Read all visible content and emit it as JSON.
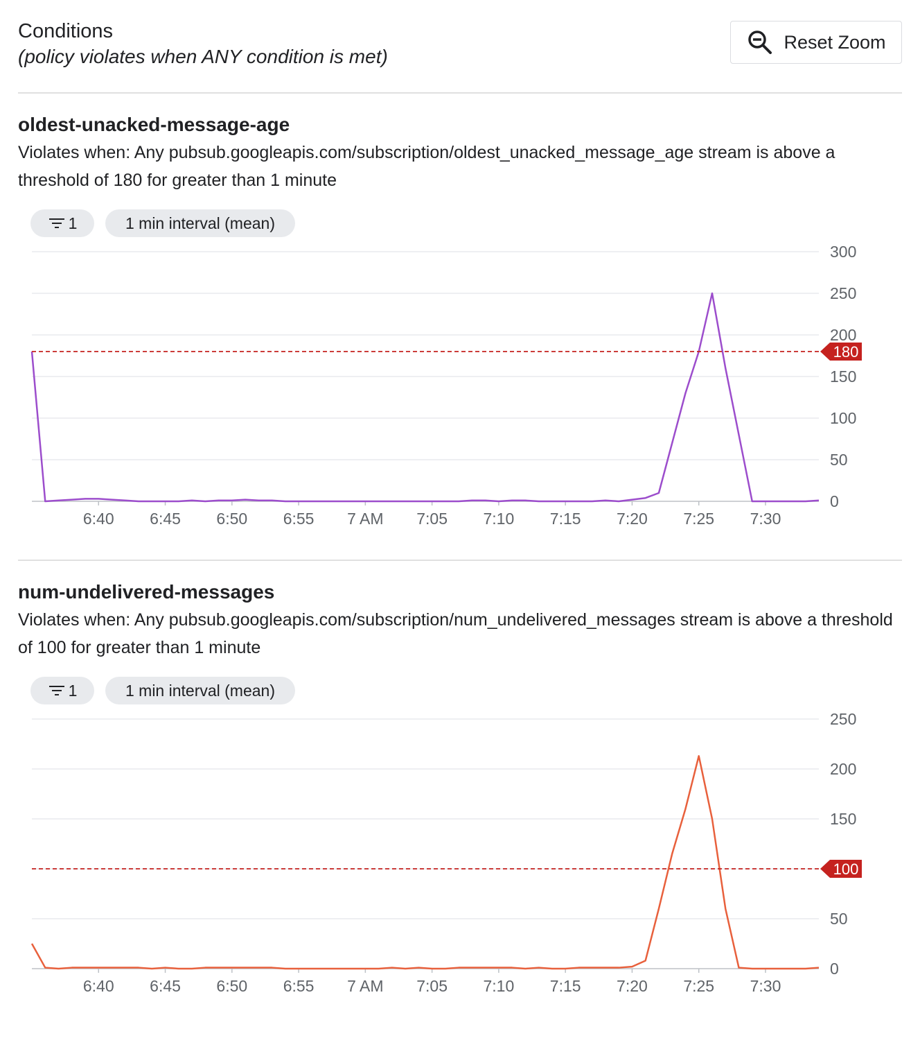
{
  "header": {
    "title": "Conditions",
    "subtitle": "(policy violates when ANY condition is met)",
    "reset_zoom_label": "Reset Zoom",
    "reset_zoom_icon": "zoom-out-icon"
  },
  "conditions": [
    {
      "name": "oldest-unacked-message-age",
      "description": "Violates when: Any pubsub.googleapis.com/subscription/oldest_unacked_message_age stream is above a threshold of 180 for greater than 1 minute",
      "filter_chip_icon": "filter-icon",
      "filter_chip_count": "1",
      "interval_chip": "1 min interval (mean)",
      "threshold_label": "180"
    },
    {
      "name": "num-undelivered-messages",
      "description": "Violates when: Any pubsub.googleapis.com/subscription/num_undelivered_messages stream is above a threshold of 100 for greater than 1 minute",
      "filter_chip_icon": "filter-icon",
      "filter_chip_count": "1",
      "interval_chip": "1 min interval (mean)",
      "threshold_label": "100"
    }
  ],
  "chart_data": [
    {
      "type": "line",
      "x_unit": "time",
      "x_ticks": [
        "6:40",
        "6:45",
        "6:50",
        "6:55",
        "7 AM",
        "7:05",
        "7:10",
        "7:15",
        "7:20",
        "7:25",
        "7:30"
      ],
      "y_ticks": [
        "0",
        "50",
        "100",
        "150",
        "200",
        "250",
        "300"
      ],
      "ylim": [
        0,
        300
      ],
      "xlim": [
        "6:35",
        "7:34"
      ],
      "grid": true,
      "threshold": 180,
      "series_color": "#9c4dcc",
      "threshold_color": "#c5221f",
      "series": [
        {
          "x": [
            "6:35",
            "6:36",
            "6:37",
            "6:38",
            "6:39",
            "6:40",
            "6:41",
            "6:42",
            "6:43",
            "6:44",
            "6:45",
            "6:46",
            "6:47",
            "6:48",
            "6:49",
            "6:50",
            "6:51",
            "6:52",
            "6:53",
            "6:54",
            "6:55",
            "6:56",
            "6:57",
            "6:58",
            "6:59",
            "7:00",
            "7:01",
            "7:02",
            "7:03",
            "7:04",
            "7:05",
            "7:06",
            "7:07",
            "7:08",
            "7:09",
            "7:10",
            "7:11",
            "7:12",
            "7:13",
            "7:14",
            "7:15",
            "7:16",
            "7:17",
            "7:18",
            "7:19",
            "7:20",
            "7:21",
            "7:22",
            "7:23",
            "7:24",
            "7:25",
            "7:26",
            "7:27",
            "7:28",
            "7:29",
            "7:30",
            "7:31",
            "7:32",
            "7:33",
            "7:34"
          ],
          "y": [
            180,
            0,
            1,
            2,
            3,
            3,
            2,
            1,
            0,
            0,
            0,
            0,
            1,
            0,
            1,
            1,
            2,
            1,
            1,
            0,
            0,
            0,
            0,
            0,
            0,
            0,
            0,
            0,
            0,
            0,
            0,
            0,
            0,
            1,
            1,
            0,
            1,
            1,
            0,
            0,
            0,
            0,
            0,
            1,
            0,
            2,
            4,
            10,
            70,
            130,
            180,
            250,
            160,
            80,
            0,
            0,
            0,
            0,
            0,
            1
          ]
        }
      ]
    },
    {
      "type": "line",
      "x_unit": "time",
      "x_ticks": [
        "6:40",
        "6:45",
        "6:50",
        "6:55",
        "7 AM",
        "7:05",
        "7:10",
        "7:15",
        "7:20",
        "7:25",
        "7:30"
      ],
      "y_ticks": [
        "0",
        "50",
        "100",
        "150",
        "200",
        "250"
      ],
      "ylim": [
        0,
        250
      ],
      "xlim": [
        "6:35",
        "7:34"
      ],
      "grid": true,
      "threshold": 100,
      "series_color": "#e8603c",
      "threshold_color": "#c5221f",
      "series": [
        {
          "x": [
            "6:35",
            "6:36",
            "6:37",
            "6:38",
            "6:39",
            "6:40",
            "6:41",
            "6:42",
            "6:43",
            "6:44",
            "6:45",
            "6:46",
            "6:47",
            "6:48",
            "6:49",
            "6:50",
            "6:51",
            "6:52",
            "6:53",
            "6:54",
            "6:55",
            "6:56",
            "6:57",
            "6:58",
            "6:59",
            "7:00",
            "7:01",
            "7:02",
            "7:03",
            "7:04",
            "7:05",
            "7:06",
            "7:07",
            "7:08",
            "7:09",
            "7:10",
            "7:11",
            "7:12",
            "7:13",
            "7:14",
            "7:15",
            "7:16",
            "7:17",
            "7:18",
            "7:19",
            "7:20",
            "7:21",
            "7:22",
            "7:23",
            "7:24",
            "7:25",
            "7:26",
            "7:27",
            "7:28",
            "7:29",
            "7:30",
            "7:31",
            "7:32",
            "7:33",
            "7:34"
          ],
          "y": [
            25,
            1,
            0,
            1,
            1,
            1,
            1,
            1,
            1,
            0,
            1,
            0,
            0,
            1,
            1,
            1,
            1,
            1,
            1,
            0,
            0,
            0,
            0,
            0,
            0,
            0,
            0,
            1,
            0,
            1,
            0,
            0,
            1,
            1,
            1,
            1,
            1,
            0,
            1,
            0,
            0,
            1,
            1,
            1,
            1,
            2,
            8,
            60,
            115,
            160,
            213,
            150,
            60,
            1,
            0,
            0,
            0,
            0,
            0,
            1
          ]
        }
      ]
    }
  ]
}
